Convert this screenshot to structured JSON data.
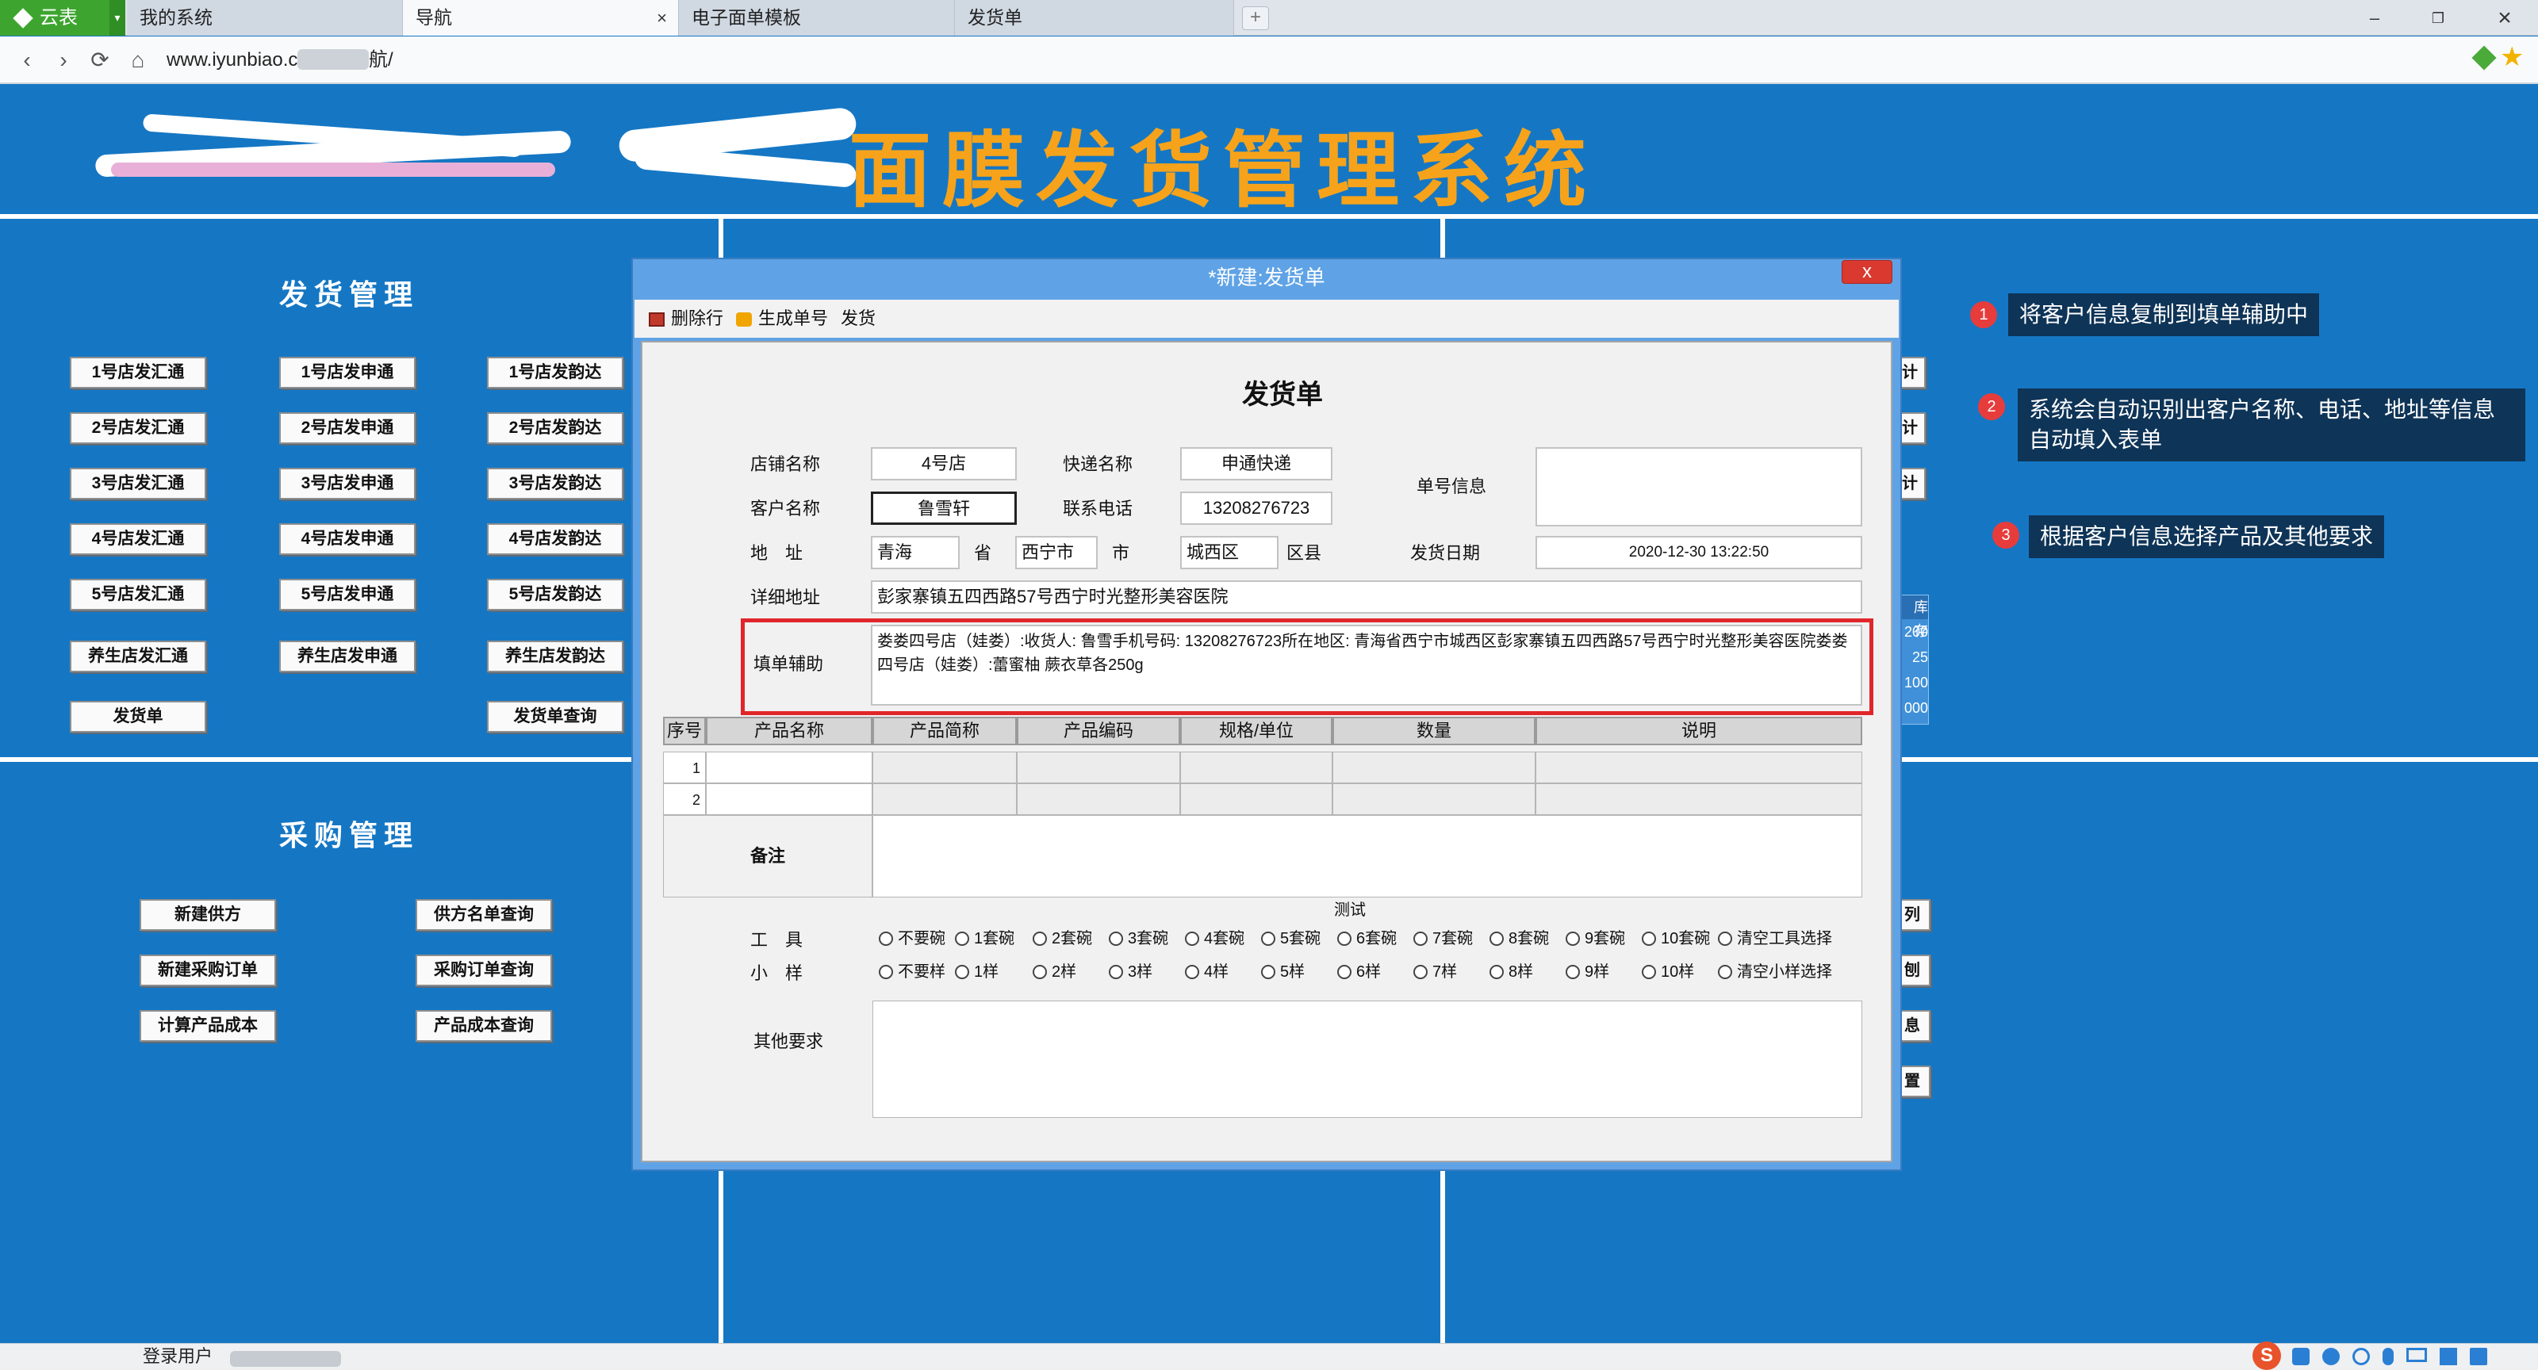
{
  "browser": {
    "brand": "云表",
    "tabs": [
      "我的系统",
      "导航",
      "电子面单模板",
      "发货单"
    ],
    "tab_close": "×",
    "new_tab": "+",
    "url": "www.iyunbiao.cn/",
    "url_tail": "航/",
    "controls": {
      "min": "–",
      "restore": "❐",
      "close": "×",
      "back": "‹",
      "forward": "›",
      "refresh": "⟳",
      "home": "⌂"
    }
  },
  "app": {
    "system_title": "面膜发货管理系统",
    "shipping_section": {
      "title": "发货管理",
      "buttons": [
        [
          "1号店发汇通",
          "1号店发申通",
          "1号店发韵达"
        ],
        [
          "2号店发汇通",
          "2号店发申通",
          "2号店发韵达"
        ],
        [
          "3号店发汇通",
          "3号店发申通",
          "3号店发韵达"
        ],
        [
          "4号店发汇通",
          "4号店发申通",
          "4号店发韵达"
        ],
        [
          "5号店发汇通",
          "5号店发申通",
          "5号店发韵达"
        ],
        [
          "养生店发汇通",
          "养生店发申通",
          "养生店发韵达"
        ]
      ],
      "extra": [
        "发货单",
        "发货单查询"
      ]
    },
    "purchase_section": {
      "title": "采购管理",
      "buttons": [
        "新建供方",
        "供方名单查询",
        "新建采购订单",
        "采购订单查询",
        "计算产品成本",
        "产品成本查询"
      ]
    },
    "right_peek": [
      "计",
      "计",
      "计",
      "库存",
      "200",
      "25",
      "100",
      "000",
      "列",
      "刨",
      "息",
      "置"
    ],
    "status": {
      "user_label": "登录用户"
    }
  },
  "dialog": {
    "title": "*新建:发货单",
    "close": "x",
    "toolbar": [
      "删除行",
      "生成单号",
      "发货"
    ],
    "form_title": "发货单",
    "fields": {
      "store_label": "店铺名称",
      "store_value": "4号店",
      "courier_label": "快递名称",
      "courier_value": "申通快递",
      "order_info_label": "单号信息",
      "customer_label": "客户名称",
      "customer_value": "鲁雪轩",
      "phone_label": "联系电话",
      "phone_value": "13208276723",
      "address_label": "地　址",
      "province_value": "青海",
      "province_suffix": "省",
      "city_value": "西宁市",
      "city_suffix": "市",
      "district_value": "城西区",
      "district_suffix": "区县",
      "date_label": "发货日期",
      "date_value": "2020-12-30 13:22:50",
      "detail_label": "详细地址",
      "detail_value": "彭家寨镇五四西路57号西宁时光整形美容医院",
      "assist_label": "填单辅助",
      "assist_value": "娄娄四号店（娃娄）:收货人: 鲁雪手机号码: 13208276723所在地区: 青海省西宁市城西区彭家寨镇五四西路57号西宁时光整形美容医院娄娄四号店（娃娄）:蕾蜜柚 蕨衣草各250g"
    },
    "table": {
      "headers": [
        "序号",
        "产品名称",
        "产品简称",
        "产品编码",
        "规格/单位",
        "数量",
        "说明"
      ],
      "rows": [
        "1",
        "2"
      ],
      "remark_label": "备注"
    },
    "test_label": "测试",
    "tools": {
      "label": "工　具",
      "options": [
        "不要碗",
        "1套碗",
        "2套碗",
        "3套碗",
        "4套碗",
        "5套碗",
        "6套碗",
        "7套碗",
        "8套碗",
        "9套碗",
        "10套碗",
        "清空工具选择"
      ]
    },
    "samples": {
      "label": "小　样",
      "options": [
        "不要样",
        "1样",
        "2样",
        "3样",
        "4样",
        "5样",
        "6样",
        "7样",
        "8样",
        "9样",
        "10样",
        "清空小样选择"
      ]
    },
    "other_label": "其他要求"
  },
  "annotations": [
    {
      "num": "1",
      "text": "将客户信息复制到填单辅助中"
    },
    {
      "num": "2",
      "text": "系统会自动识别出客户名称、电话、地址等信息自动填入表单"
    },
    {
      "num": "3",
      "text": "根据客户信息选择产品及其他要求"
    }
  ],
  "colors": {
    "background": "#1577c4",
    "title_orange": "#f6a31b",
    "highlight_red": "#e0262b",
    "annotation_bg": "#0e3457"
  }
}
